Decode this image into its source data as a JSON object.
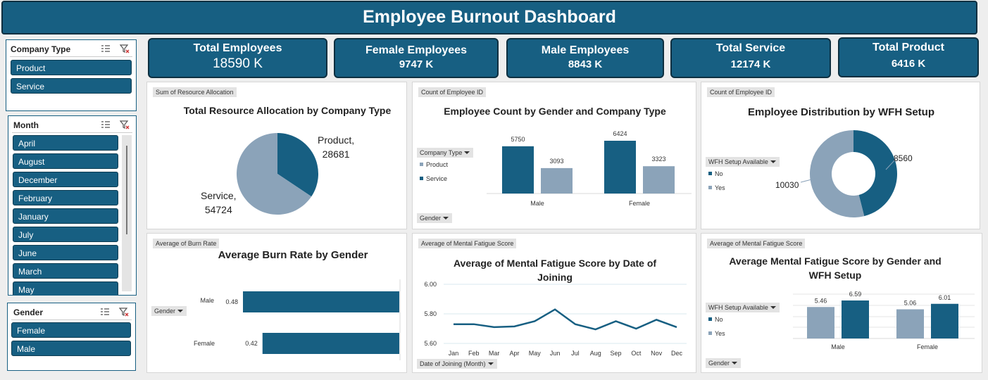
{
  "title": "Employee Burnout Dashboard",
  "colors": {
    "dark": "#175f82",
    "light": "#8ba3b9",
    "banner": "#175f82"
  },
  "slicers": {
    "company": {
      "label": "Company Type",
      "items": [
        "Product",
        "Service"
      ]
    },
    "month": {
      "label": "Month",
      "items": [
        "April",
        "August",
        "December",
        "February",
        "January",
        "July",
        "June",
        "March",
        "May"
      ]
    },
    "gender": {
      "label": "Gender",
      "items": [
        "Female",
        "Male"
      ]
    }
  },
  "kpis": [
    {
      "label": "Total Employees",
      "value": "18590 K"
    },
    {
      "label": "Female Employees",
      "value": "9747 K"
    },
    {
      "label": "Male Employees",
      "value": "8843 K"
    },
    {
      "label": "Total Service",
      "value": "12174 K"
    },
    {
      "label": "Total Product",
      "value": "6416 K"
    }
  ],
  "charts": {
    "resource": {
      "tag": "Sum of Resource  Allocation",
      "title": "Total Resource Allocation by Company Type",
      "product_label": "Product,",
      "product_value": "28681",
      "service_label": "Service,",
      "service_value": "54724"
    },
    "empcount": {
      "tag": "Count of Employee ID",
      "title": "Employee Count by Gender and Company Type",
      "legend_dd": "Company Type",
      "legend": [
        "Product",
        "Service"
      ],
      "axis_dd": "Gender",
      "labels": [
        "5750",
        "3093",
        "6424",
        "3323"
      ],
      "cats": [
        "Male",
        "Female"
      ]
    },
    "wfh": {
      "tag": "Count of Employee ID",
      "title": "Employee Distribution by WFH Setup",
      "legend_dd": "WFH Setup Available",
      "legend": [
        "No",
        "Yes"
      ],
      "no_label": "8560",
      "yes_label": "10030"
    },
    "burn": {
      "tag": "Average of Burn Rate",
      "title": "Average Burn Rate by Gender",
      "axis_dd": "Gender",
      "cats": [
        "Male",
        "Female"
      ],
      "labels": [
        "0.48",
        "0.42"
      ]
    },
    "fatigue_date": {
      "tag": "Average of Mental Fatigue Score",
      "title1": "Average of Mental Fatigue Score by Date of",
      "title2": "Joining",
      "axis_dd": "Date of Joining (Month)",
      "yticks": [
        "6.00",
        "5.80",
        "5.60"
      ],
      "months": [
        "Jan",
        "Feb",
        "Mar",
        "Apr",
        "May",
        "Jun",
        "Jul",
        "Aug",
        "Sep",
        "Oct",
        "Nov",
        "Dec"
      ]
    },
    "fatigue_gender": {
      "tag": "Average of Mental Fatigue Score",
      "title1": "Average Mental Fatigue Score by Gender and",
      "title2": "WFH Setup",
      "legend_dd": "WFH Setup Available",
      "legend": [
        "No",
        "Yes"
      ],
      "axis_dd": "Gender",
      "labels": [
        "5.46",
        "6.59",
        "5.06",
        "6.01"
      ],
      "cats": [
        "Male",
        "Female"
      ]
    }
  },
  "chart_data": [
    {
      "type": "pie",
      "title": "Total Resource Allocation by Company Type",
      "categories": [
        "Product",
        "Service"
      ],
      "values": [
        28681,
        54724
      ]
    },
    {
      "type": "bar",
      "title": "Employee Count by Gender and Company Type",
      "categories": [
        "Male",
        "Female"
      ],
      "series": [
        {
          "name": "Product",
          "values": [
            5750,
            6424
          ]
        },
        {
          "name": "Service",
          "values": [
            3093,
            3323
          ]
        }
      ]
    },
    {
      "type": "pie",
      "title": "Employee Distribution by WFH Setup",
      "categories": [
        "No",
        "Yes"
      ],
      "values": [
        8560,
        10030
      ]
    },
    {
      "type": "bar",
      "title": "Average Burn Rate by Gender",
      "categories": [
        "Male",
        "Female"
      ],
      "values": [
        0.48,
        0.42
      ]
    },
    {
      "type": "line",
      "title": "Average of Mental Fatigue Score by Date of Joining",
      "categories": [
        "Jan",
        "Feb",
        "Mar",
        "Apr",
        "May",
        "Jun",
        "Jul",
        "Aug",
        "Sep",
        "Oct",
        "Nov",
        "Dec"
      ],
      "values": [
        5.73,
        5.73,
        5.71,
        5.715,
        5.75,
        5.83,
        5.73,
        5.695,
        5.75,
        5.7,
        5.76,
        5.71
      ],
      "ylim": [
        5.6,
        6.0
      ]
    },
    {
      "type": "bar",
      "title": "Average Mental Fatigue Score by Gender and WFH Setup",
      "categories": [
        "Male",
        "Female"
      ],
      "series": [
        {
          "name": "No",
          "values": [
            5.46,
            5.06
          ]
        },
        {
          "name": "Yes",
          "values": [
            6.59,
            6.01
          ]
        }
      ]
    }
  ]
}
